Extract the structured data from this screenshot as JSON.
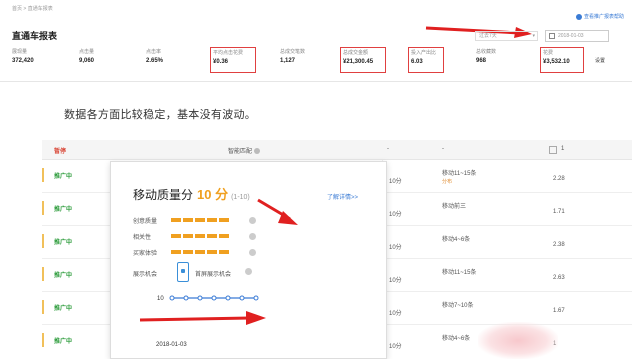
{
  "header": {
    "breadcrumb": "首页 > 直通车报表",
    "help_link": "查看推广报表帮助",
    "title": "直通车报表",
    "date_select": "过去7天",
    "date_input": "2018-01-03",
    "settings": "设置"
  },
  "metrics": [
    {
      "label": "展现量",
      "value": "372,420",
      "boxed": false
    },
    {
      "label": "点击量",
      "value": "9,060",
      "boxed": false
    },
    {
      "label": "点击率",
      "value": "2.65%",
      "boxed": false
    },
    {
      "label": "平均点击花费",
      "value": "¥0.36",
      "boxed": true
    },
    {
      "label": "总成交笔数",
      "value": "1,127",
      "boxed": false
    },
    {
      "label": "总成交金额",
      "value": "¥21,300.45",
      "boxed": true
    },
    {
      "label": "投入产出比",
      "value": "6.03",
      "boxed": true
    },
    {
      "label": "总收藏数",
      "value": "968",
      "boxed": false
    },
    {
      "label": "花费",
      "value": "¥3,532.10",
      "boxed": true
    }
  ],
  "caption": "数据各方面比较稳定，基本没有波动。",
  "table": {
    "header_status": "暂停",
    "header_match": "智能匹配",
    "header_dash1": "-",
    "header_dash2": "-",
    "header_right": "1",
    "rows": [
      {
        "status": "推广中",
        "score": "10分",
        "rank": "移动11~15条",
        "rank_sub": "分布",
        "num": "2.28"
      },
      {
        "status": "推广中",
        "score": "10分",
        "rank": "移动前三",
        "rank_sub": "",
        "num": "1.71"
      },
      {
        "status": "推广中",
        "score": "10分",
        "rank": "移动4~6条",
        "rank_sub": "",
        "num": "2.38"
      },
      {
        "status": "推广中",
        "score": "10分",
        "rank": "移动11~15条",
        "rank_sub": "",
        "num": "2.63"
      },
      {
        "status": "推广中",
        "score": "10分",
        "rank": "移动7~10条",
        "rank_sub": "",
        "num": "1.67"
      },
      {
        "status": "推广中",
        "score": "10分",
        "rank": "移动4~6条",
        "rank_sub": "",
        "num": "1"
      }
    ]
  },
  "popup": {
    "title": "移动质量分",
    "score": "10 分",
    "range": "(1-10)",
    "link": "了解详情>>",
    "dimensions": [
      {
        "label": "创意质量",
        "filled": 5
      },
      {
        "label": "相关性",
        "filled": 5
      },
      {
        "label": "买家体验",
        "filled": 5
      }
    ],
    "show_label": "展示机会",
    "show_value": "首屏展示机会",
    "spark_value": "10",
    "spark_date": "2018-01-03",
    "spark_points": [
      10,
      10,
      10,
      10,
      10,
      10,
      10
    ]
  },
  "colors": {
    "accent": "#f0a020",
    "link": "#3a7bd5",
    "status_green": "#2b9b3a",
    "arrow_red": "#e02020"
  }
}
